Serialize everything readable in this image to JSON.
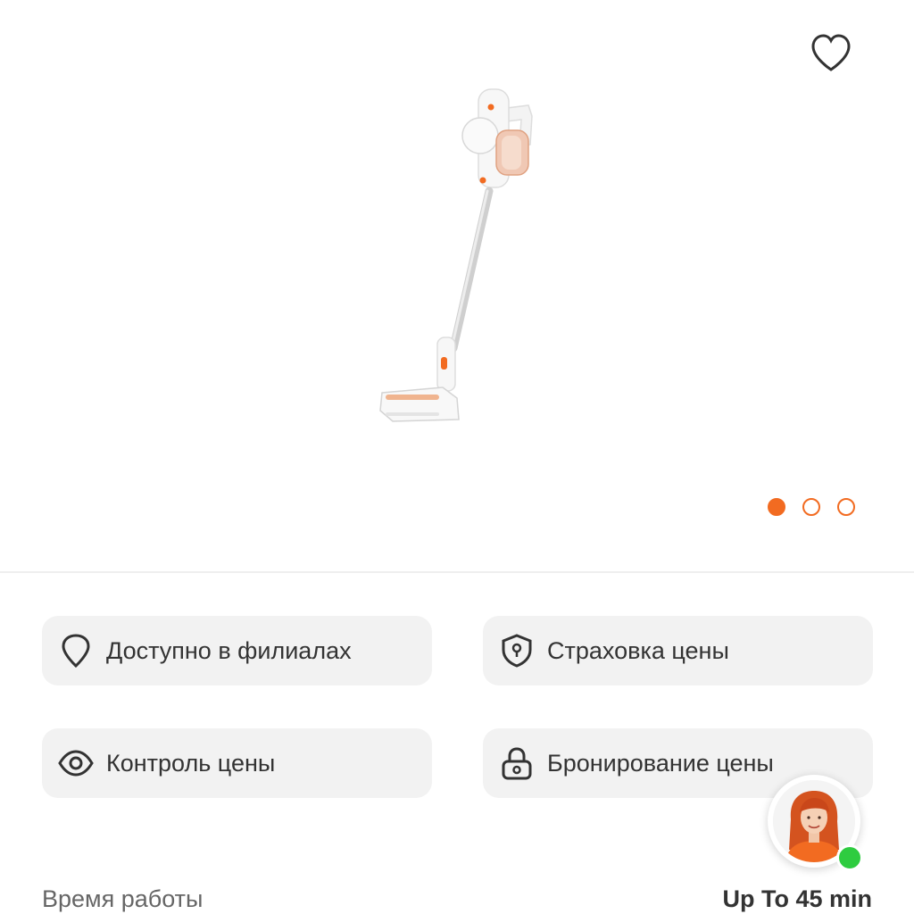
{
  "colors": {
    "accent": "#f26b21",
    "card_background": "#f2f2f2",
    "online_status": "#2ecc40",
    "text_primary": "#333333",
    "text_secondary": "#666666"
  },
  "gallery": {
    "image": "stick-vacuum-cleaner-product-photo",
    "favorite_icon": "heart-outline-icon",
    "dots_count": 3,
    "active_dot": 1
  },
  "features": [
    {
      "label": "Доступно в филиалах",
      "icon": "location-pin-icon"
    },
    {
      "label": "Страховка цены",
      "icon": "shield-icon"
    },
    {
      "label": "Контроль цены",
      "icon": "eye-icon"
    },
    {
      "label": "Бронирование цены",
      "icon": "lock-icon"
    }
  ],
  "info": {
    "work_time_label": "Время работы",
    "delivery_time": "Up To 45 min"
  },
  "assistant": {
    "avatar": "support-assistant-avatar",
    "status": "online"
  }
}
